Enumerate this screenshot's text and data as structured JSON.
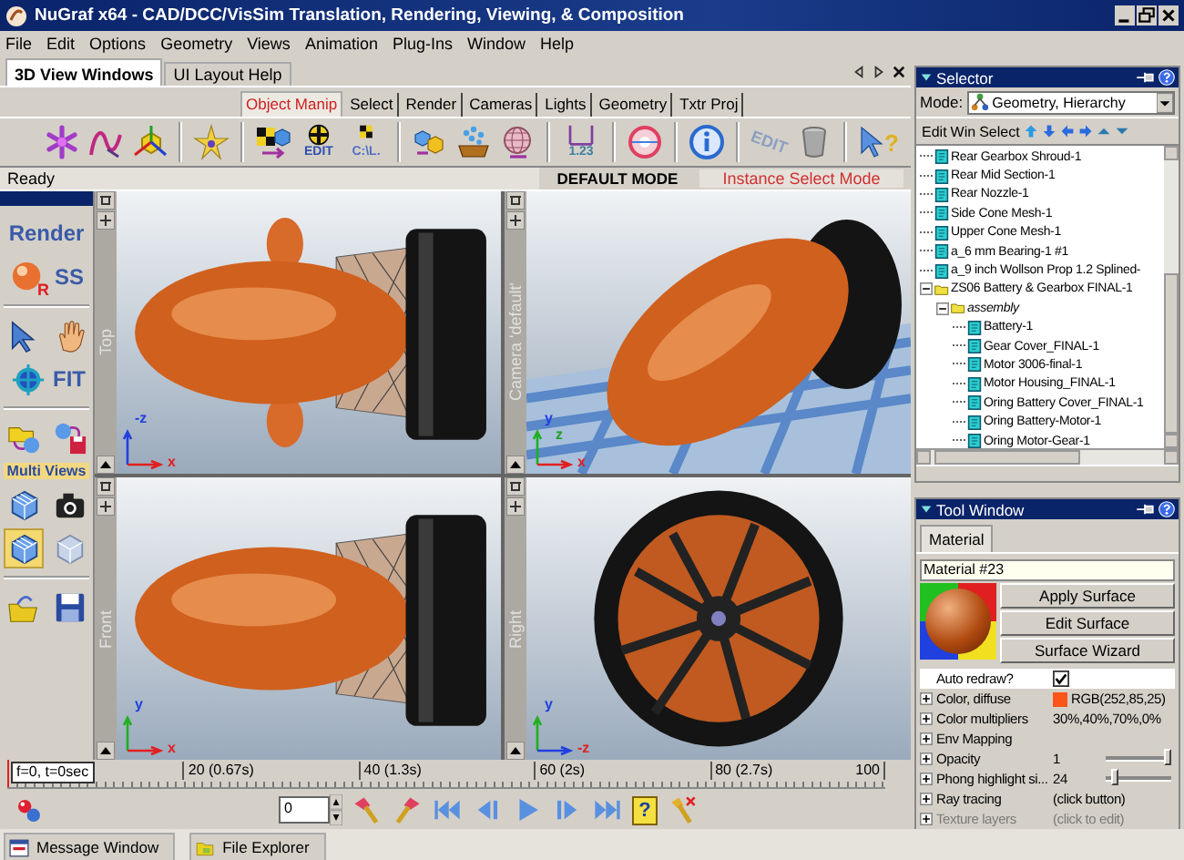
{
  "window": {
    "title": "NuGraf x64 - CAD/DCC/VisSim Translation, Rendering, Viewing, & Composition"
  },
  "menu": [
    "File",
    "Edit",
    "Options",
    "Geometry",
    "Views",
    "Animation",
    "Plug-Ins",
    "Window",
    "Help"
  ],
  "document_tabs": [
    {
      "label": "3D View Windows",
      "selected": true
    },
    {
      "label": "UI Layout Help",
      "selected": false
    }
  ],
  "toolbar_tabs": [
    {
      "label": "Object Manip",
      "selected": true
    },
    {
      "label": "Select",
      "selected": false
    },
    {
      "label": "Render",
      "selected": false
    },
    {
      "label": "Cameras",
      "selected": false
    },
    {
      "label": "Lights",
      "selected": false
    },
    {
      "label": "Geometry",
      "selected": false
    },
    {
      "label": "Txtr Proj",
      "selected": false
    }
  ],
  "toolbar": [
    {
      "kind": "star"
    },
    {
      "kind": "curve"
    },
    {
      "kind": "axes"
    },
    {
      "kind": "separator"
    },
    {
      "kind": "star-small"
    },
    {
      "kind": "separator"
    },
    {
      "kind": "checker-cube"
    },
    {
      "kind": "checker-edit",
      "caption": "EDIT"
    },
    {
      "kind": "checker-path",
      "caption": "C:\\L."
    },
    {
      "kind": "separator"
    },
    {
      "kind": "cubes"
    },
    {
      "kind": "tub"
    },
    {
      "kind": "globe"
    },
    {
      "kind": "separator"
    },
    {
      "kind": "ruler",
      "caption": "1.23"
    },
    {
      "kind": "separator"
    },
    {
      "kind": "ring"
    },
    {
      "kind": "separator"
    },
    {
      "kind": "info"
    },
    {
      "kind": "separator"
    },
    {
      "kind": "edit-text",
      "caption": "EDIT"
    },
    {
      "kind": "trash"
    },
    {
      "kind": "separator"
    },
    {
      "kind": "help-arrow",
      "caption": "?"
    }
  ],
  "status": {
    "message": "Ready",
    "mode": "DEFAULT MODE",
    "select_mode": "Instance Select Mode"
  },
  "left_toolbar": [
    {
      "kind": "tools",
      "tools": [
        {
          "kind": "label",
          "text": "Render",
          "selected": false
        }
      ]
    },
    {
      "kind": "tools",
      "tools": [
        {
          "kind": "sphere-r",
          "caption": "R",
          "selected": false
        },
        {
          "kind": "label",
          "text": "SS",
          "selected": false
        }
      ]
    },
    {
      "kind": "separator"
    },
    {
      "kind": "tools",
      "tools": [
        {
          "kind": "arrow",
          "selected": false
        },
        {
          "kind": "hand",
          "selected": false
        }
      ]
    },
    {
      "kind": "tools",
      "tools": [
        {
          "kind": "target",
          "selected": false
        },
        {
          "kind": "label",
          "text": "FIT",
          "selected": false
        }
      ]
    },
    {
      "kind": "separator"
    },
    {
      "kind": "tools",
      "tools": [
        {
          "kind": "folder-sphere",
          "selected": false
        },
        {
          "kind": "sphere-floppy",
          "selected": false
        }
      ]
    },
    {
      "kind": "heading",
      "text": "Multi Views"
    },
    {
      "kind": "tools",
      "tools": [
        {
          "kind": "cube-grid",
          "selected": false
        },
        {
          "kind": "camera",
          "selected": false
        }
      ]
    },
    {
      "kind": "tools",
      "tools": [
        {
          "kind": "cube-grid",
          "selected": true
        },
        {
          "kind": "cube-faded",
          "selected": false
        }
      ]
    },
    {
      "kind": "separator"
    },
    {
      "kind": "tools",
      "tools": [
        {
          "kind": "folder",
          "selected": false
        },
        {
          "kind": "floppy",
          "selected": false
        }
      ]
    }
  ],
  "viewports": [
    {
      "label": "Top",
      "kind": "top",
      "axis_up": "-z",
      "axis_right": "x"
    },
    {
      "label": "Camera 'default'",
      "kind": "camera",
      "axis_up": "y",
      "axis_right": "x",
      "axis_depth": "z"
    },
    {
      "label": "Front",
      "kind": "front",
      "axis_up": "y",
      "axis_right": "x"
    },
    {
      "label": "Right",
      "kind": "right",
      "axis_up": "y",
      "axis_right": "-z"
    }
  ],
  "timeline": {
    "level": 0,
    "labels": [
      "f=0, t=0sec",
      "20 (0.67s)",
      "40 (1.3s)",
      "60 (2s)",
      "80 (2.7s)",
      "100"
    ]
  },
  "playback": {
    "frame": "0",
    "buttons": [
      {
        "kind": "key-add"
      },
      {
        "kind": "key-remove"
      },
      {
        "kind": "first"
      },
      {
        "kind": "prev"
      },
      {
        "kind": "play"
      },
      {
        "kind": "next"
      },
      {
        "kind": "last"
      },
      {
        "kind": "help",
        "caption": "?"
      },
      {
        "kind": "key-delete"
      }
    ]
  },
  "bottom_tabs": [
    {
      "label": "Message Window",
      "kind": "message"
    },
    {
      "label": "File Explorer",
      "kind": "explorer"
    }
  ],
  "selector": {
    "title": "Selector",
    "mode_label": "Mode:",
    "mode": "Geometry, Hierarchy",
    "toolbar": [
      "Edit",
      "Win",
      "Select"
    ],
    "tree": [
      {
        "label": "Rear Gearbox Shroud-1",
        "kind": "mesh"
      },
      {
        "label": "Rear Mid Section-1",
        "kind": "mesh"
      },
      {
        "label": "Rear Nozzle-1",
        "kind": "mesh"
      },
      {
        "label": "Side Cone Mesh-1",
        "kind": "mesh"
      },
      {
        "label": "Upper Cone Mesh-1",
        "kind": "mesh"
      },
      {
        "label": "a_6 mm Bearing-1 #1",
        "kind": "mesh"
      },
      {
        "label": "a_9 inch Wollson Prop 1.2 Splined-",
        "kind": "mesh"
      },
      {
        "label": "ZS06 Battery & Gearbox FINAL-1",
        "kind": "folder",
        "expanded": true,
        "children": [
          {
            "label": "assembly",
            "kind": "assembly",
            "expanded": true,
            "children": [
              {
                "label": "Battery-1",
                "kind": "mesh"
              },
              {
                "label": "Gear Cover_FINAL-1",
                "kind": "mesh"
              },
              {
                "label": "Motor 3006-final-1",
                "kind": "mesh"
              },
              {
                "label": "Motor Housing_FINAL-1",
                "kind": "mesh"
              },
              {
                "label": "Oring Battery Cover_FINAL-1",
                "kind": "mesh"
              },
              {
                "label": "Oring Battery-Motor-1",
                "kind": "mesh"
              },
              {
                "label": "Oring Motor-Gear-1",
                "kind": "mesh"
              }
            ]
          }
        ]
      }
    ]
  },
  "tool_window": {
    "title": "Tool Window",
    "tabs": [
      {
        "label": "Material",
        "selected": true
      }
    ],
    "material_name": "Material #23",
    "buttons": [
      "Apply Surface",
      "Edit Surface",
      "Surface Wizard"
    ],
    "properties": [
      {
        "label": "Auto redraw?",
        "kind": "checkbox",
        "checked": true,
        "expandable": false,
        "disabled": false
      },
      {
        "label": "Color, diffuse",
        "kind": "color",
        "color": "#fc5519",
        "value": "RGB(252,85,25)",
        "expandable": true,
        "disabled": false
      },
      {
        "label": "Color multipliers",
        "kind": "text",
        "value": "30%,40%,70%,0%",
        "expandable": true,
        "disabled": false
      },
      {
        "label": "Env Mapping",
        "kind": "text",
        "expandable": true,
        "disabled": false
      },
      {
        "label": "Opacity",
        "kind": "slider",
        "value": "1",
        "level": 1,
        "expandable": true,
        "disabled": false
      },
      {
        "label": "Phong highlight si...",
        "kind": "slider",
        "value": "24",
        "level": 0.1,
        "expandable": true,
        "disabled": false
      },
      {
        "label": "Ray tracing",
        "kind": "text",
        "value": "(click button)",
        "expandable": true,
        "disabled": false
      },
      {
        "label": "Texture layers",
        "kind": "text",
        "value": "(click to edit)",
        "expandable": true,
        "disabled": true
      }
    ]
  }
}
